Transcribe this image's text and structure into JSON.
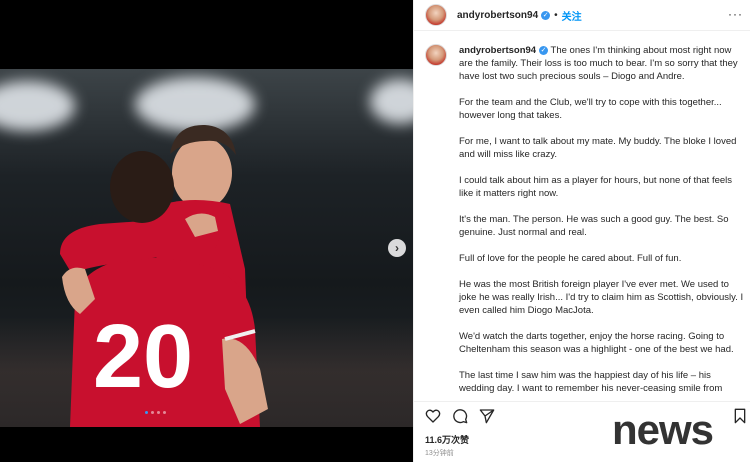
{
  "post": {
    "username": "andyrobertson94",
    "separator": "•",
    "follow_label": "关注",
    "more_label": "···",
    "next_label": "›",
    "views": "11.6万次赞",
    "time": "13分钟前"
  },
  "caption": {
    "paragraphs": [
      "The ones I'm thinking about most right now are the family. Their loss is too much to bear. I'm so sorry that they have lost two such precious souls – Diogo and Andre.",
      "For the team and the Club, we'll try to cope with this together... however long that takes.",
      "For me, I want to talk about my mate. My buddy. The bloke I loved and will miss like crazy.",
      "I could talk about him as a player for hours, but none of that feels like it matters right now.",
      "It's the man. The person. He was such a good guy. The best. So genuine. Just normal and real.",
      "Full of love for the people he cared about. Full of fun.",
      "He was the most British foreign player I've ever met. We used to joke he was really Irish... I'd try to claim him as Scottish, obviously. I even called him Diogo MacJota.",
      "We'd watch the darts together, enjoy the horse racing. Going to Cheltenham this season was a highlight - one of the best we had.",
      "The last time I saw him was the happiest day of his life – his wedding day. I want to remember his never-ceasing smile from"
    ]
  },
  "photo": {
    "jersey_number": "20"
  },
  "icons": [
    "heart-icon",
    "comment-icon",
    "share-icon",
    "bookmark-icon",
    "verified-icon",
    "chevron-right-icon"
  ],
  "watermark": "news",
  "colors": {
    "accent": "#0095f6",
    "jersey": "#c8102e"
  }
}
